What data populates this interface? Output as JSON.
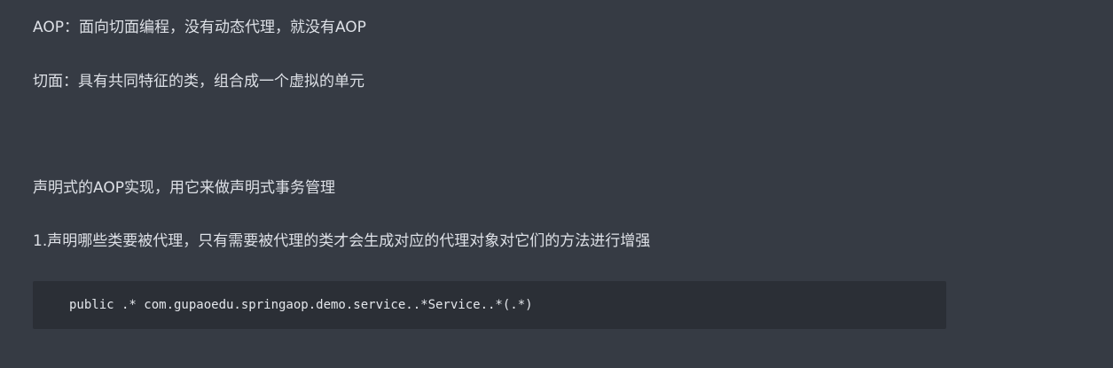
{
  "document": {
    "paragraphs": [
      "AOP：面向切面编程，没有动态代理，就没有AOP",
      "切面：具有共同特征的类，组合成一个虚拟的单元",
      "声明式的AOP实现，用它来做声明式事务管理",
      "1.声明哪些类要被代理，只有需要被代理的类才会生成对应的代理对象对它们的方法进行增强"
    ],
    "code": "public .* com.gupaoedu.springaop.demo.service..*Service..*(.*)"
  },
  "colors": {
    "background": "#363b44",
    "text": "#dde0e6",
    "code_background": "#2b2f36"
  }
}
